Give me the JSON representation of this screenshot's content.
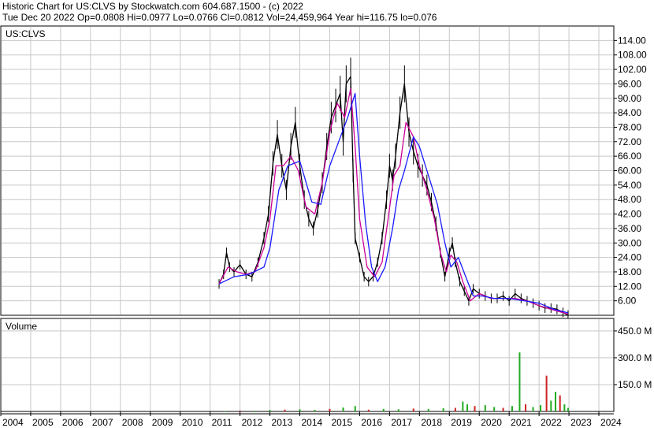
{
  "header": {
    "line1": "Historic Chart for US:CLVS by Stockwatch.com 604.687.1500 - (c) 2022",
    "line2": "Tue Dec 20 2022   Op=0.0808   Hi=0.0977   Lo=0.0766   Cl=0.0812   Vol=24,459,964   Year hi=116.75   lo=0.076"
  },
  "price_panel_label": "US:CLVS",
  "volume_panel_label": "Volume",
  "colors": {
    "price": "#000000",
    "ma_short": "#cc0099",
    "ma_long": "#1a1aff",
    "grid": "#c8c8c8",
    "vol_up": "#22aa22",
    "vol_down": "#cc2222"
  },
  "chart_data": [
    {
      "type": "line",
      "title": "",
      "x_unit": "year",
      "ylim": [
        0,
        120
      ],
      "xlim": [
        2004,
        2024.5
      ],
      "y_ticks": [
        6,
        12,
        18,
        24,
        30,
        36,
        42,
        48,
        54,
        60,
        66,
        72,
        78,
        84,
        90,
        96,
        102,
        108,
        114
      ],
      "y_tick_labels": [
        "6.00",
        "12.00",
        "18.00",
        "24.00",
        "30.00",
        "36.00",
        "42.00",
        "48.00",
        "54.00",
        "60.00",
        "66.00",
        "72.00",
        "78.00",
        "84.00",
        "90.00",
        "96.00",
        "102.00",
        "108.00",
        "114.00"
      ],
      "grid": true,
      "series": [
        {
          "role": "price",
          "x": [
            2011.3,
            2011.45,
            2011.55,
            2011.65,
            2011.8,
            2012.0,
            2012.2,
            2012.4,
            2012.6,
            2012.8,
            2012.95,
            2013.1,
            2013.25,
            2013.4,
            2013.55,
            2013.7,
            2013.85,
            2014.0,
            2014.15,
            2014.3,
            2014.45,
            2014.6,
            2014.75,
            2014.9,
            2015.05,
            2015.2,
            2015.35,
            2015.45,
            2015.55,
            2015.7,
            2015.78,
            2015.85,
            2016.0,
            2016.15,
            2016.3,
            2016.45,
            2016.6,
            2016.75,
            2016.9,
            2017.0,
            2017.1,
            2017.2,
            2017.35,
            2017.5,
            2017.65,
            2017.8,
            2017.95,
            2018.1,
            2018.25,
            2018.4,
            2018.55,
            2018.7,
            2018.85,
            2019.0,
            2019.1,
            2019.2,
            2019.35,
            2019.5,
            2019.65,
            2019.8,
            2020.0,
            2020.2,
            2020.4,
            2020.6,
            2020.8,
            2021.0,
            2021.2,
            2021.4,
            2021.6,
            2021.8,
            2022.0,
            2022.2,
            2022.4,
            2022.6,
            2022.8,
            2022.97
          ],
          "y": [
            13,
            17,
            26,
            20,
            18,
            21,
            17,
            16,
            22,
            32,
            42,
            63,
            75,
            62,
            52,
            70,
            80,
            62,
            48,
            40,
            36,
            44,
            55,
            70,
            82,
            87,
            92,
            72,
            96,
            99,
            60,
            32,
            24,
            16,
            14,
            16,
            22,
            32,
            48,
            62,
            56,
            66,
            84,
            96,
            76,
            68,
            62,
            58,
            54,
            47,
            38,
            26,
            16,
            26,
            30,
            22,
            14,
            10,
            6,
            11,
            9,
            8,
            7,
            7,
            8,
            6,
            9,
            7,
            6,
            5,
            4,
            3,
            3,
            2.5,
            1.2,
            0.08
          ]
        },
        {
          "role": "ma_short",
          "x": [
            2011.3,
            2011.6,
            2011.9,
            2012.2,
            2012.5,
            2012.8,
            2013.0,
            2013.2,
            2013.45,
            2013.7,
            2013.95,
            2014.2,
            2014.5,
            2014.75,
            2015.0,
            2015.25,
            2015.5,
            2015.7,
            2015.85,
            2016.0,
            2016.25,
            2016.5,
            2016.75,
            2016.95,
            2017.15,
            2017.35,
            2017.55,
            2017.8,
            2018.0,
            2018.25,
            2018.5,
            2018.7,
            2018.9,
            2019.05,
            2019.25,
            2019.45,
            2019.7,
            2020.0,
            2020.4,
            2020.8,
            2021.2,
            2021.6,
            2022.0,
            2022.4,
            2022.97
          ],
          "y": [
            13,
            20,
            18,
            17,
            18,
            28,
            40,
            62,
            62,
            66,
            60,
            45,
            42,
            55,
            76,
            88,
            82,
            94,
            70,
            40,
            20,
            16,
            22,
            40,
            58,
            62,
            80,
            74,
            62,
            52,
            40,
            26,
            18,
            25,
            22,
            14,
            6,
            9,
            7,
            7,
            7,
            6,
            4,
            2.5,
            0.5
          ]
        },
        {
          "role": "ma_long",
          "x": [
            2011.3,
            2011.8,
            2012.3,
            2012.8,
            2013.0,
            2013.3,
            2013.6,
            2014.0,
            2014.4,
            2014.7,
            2015.0,
            2015.3,
            2015.6,
            2015.85,
            2016.0,
            2016.2,
            2016.4,
            2016.6,
            2016.85,
            2017.1,
            2017.3,
            2017.5,
            2017.8,
            2018.0,
            2018.3,
            2018.6,
            2018.85,
            2019.05,
            2019.3,
            2019.55,
            2019.8,
            2020.1,
            2020.5,
            2021.0,
            2021.5,
            2022.0,
            2022.5,
            2022.97
          ],
          "y": [
            13,
            16,
            17,
            20,
            28,
            52,
            62,
            64,
            47,
            46,
            62,
            72,
            82,
            92,
            66,
            38,
            20,
            14,
            20,
            36,
            52,
            60,
            74,
            70,
            58,
            46,
            30,
            20,
            24,
            16,
            8,
            8,
            7,
            7,
            6,
            5,
            2.5,
            1
          ]
        }
      ]
    },
    {
      "type": "bar",
      "title": "",
      "x_unit": "year",
      "ylim": [
        0,
        520
      ],
      "xlim": [
        2004,
        2024.5
      ],
      "y_ticks": [
        150,
        300,
        450
      ],
      "y_tick_labels": [
        "150.0 M",
        "300.0 M",
        "450.0 M"
      ],
      "x_ticks": [
        2004,
        2005,
        2006,
        2007,
        2008,
        2009,
        2010,
        2011,
        2012,
        2013,
        2014,
        2015,
        2016,
        2017,
        2018,
        2019,
        2020,
        2021,
        2022,
        2023,
        2024
      ],
      "x_tick_labels": [
        "2004",
        "2005",
        "2006",
        "2007",
        "2008",
        "2009",
        "2010",
        "2011",
        "2012",
        "2013",
        "2014",
        "2015",
        "2016",
        "2017",
        "2018",
        "2019",
        "2020",
        "2021",
        "2022",
        "2023",
        "2024"
      ],
      "grid": true,
      "series": [
        {
          "role": "volume",
          "x": [
            2011.5,
            2012.0,
            2012.5,
            2013.0,
            2013.5,
            2014.0,
            2014.5,
            2015.0,
            2015.45,
            2015.85,
            2016.3,
            2016.8,
            2017.3,
            2017.8,
            2018.3,
            2018.8,
            2019.2,
            2019.45,
            2019.6,
            2019.85,
            2020.2,
            2020.5,
            2020.8,
            2021.1,
            2021.35,
            2021.55,
            2021.8,
            2022.05,
            2022.25,
            2022.4,
            2022.55,
            2022.7,
            2022.85,
            2022.97
          ],
          "y": [
            3,
            5,
            4,
            8,
            10,
            12,
            9,
            14,
            22,
            30,
            10,
            14,
            12,
            16,
            14,
            18,
            20,
            55,
            40,
            30,
            35,
            25,
            20,
            30,
            330,
            40,
            25,
            35,
            200,
            60,
            110,
            90,
            40,
            20
          ]
        }
      ]
    }
  ]
}
